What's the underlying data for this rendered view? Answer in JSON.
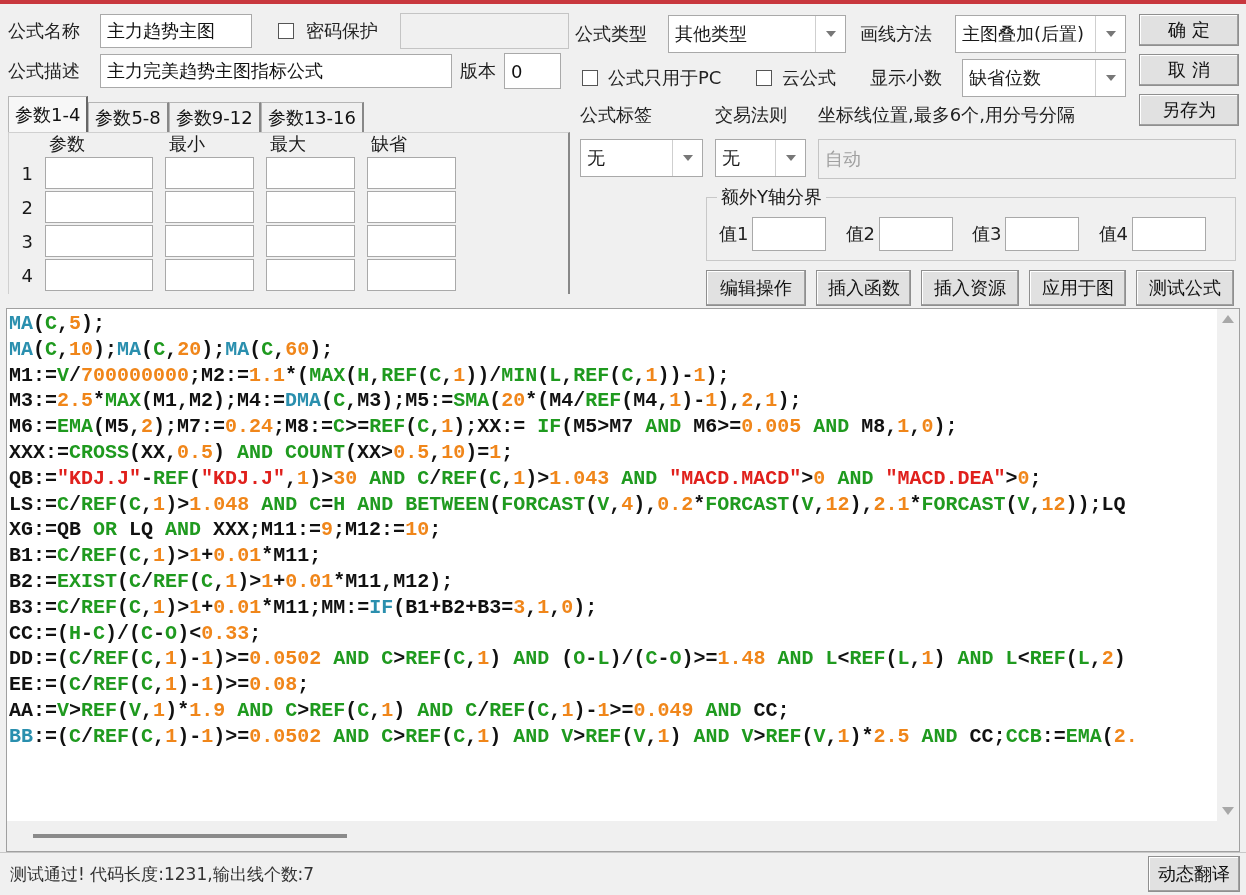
{
  "formula_name": {
    "label": "公式名称",
    "value": "主力趋势主图"
  },
  "password": {
    "label": "密码保护",
    "checked": false
  },
  "password_field": {
    "disabled": true
  },
  "description": {
    "label": "公式描述",
    "value": "主力完美趋势主图指标公式"
  },
  "version": {
    "label": "版本",
    "value": "0"
  },
  "param_tabs": [
    {
      "label": "参数1-4",
      "selected": true
    },
    {
      "label": "参数5-8",
      "selected": false
    },
    {
      "label": "参数9-12",
      "selected": false
    },
    {
      "label": "参数13-16",
      "selected": false
    }
  ],
  "param_table": {
    "columns": [
      "参数",
      "最小",
      "最大",
      "缺省"
    ],
    "rows": [
      {
        "index": "1"
      },
      {
        "index": "2"
      },
      {
        "index": "3"
      },
      {
        "index": "4"
      }
    ]
  },
  "formula_type": {
    "label": "公式类型",
    "value": "其他类型"
  },
  "draw_method": {
    "label": "画线方法",
    "value": "主图叠加(后置)"
  },
  "pc_only": {
    "label": "公式只用于PC",
    "checked": false
  },
  "cloud": {
    "label": "云公式",
    "checked": false
  },
  "decimals": {
    "label": "显示小数",
    "value": "缺省位数"
  },
  "side_buttons": [
    "确 定",
    "取 消",
    "另存为"
  ],
  "tag": {
    "label": "公式标签",
    "value": "无"
  },
  "trade_rule": {
    "label": "交易法则",
    "value": "无"
  },
  "axis_lines": {
    "label": "坐标线位置,最多6个,用分号分隔",
    "placeholder": "自动",
    "disabled": true
  },
  "extra_y": {
    "title": "额外Y轴分界",
    "fields": [
      {
        "label": "值1"
      },
      {
        "label": "值2"
      },
      {
        "label": "值3"
      },
      {
        "label": "值4"
      }
    ]
  },
  "action_buttons": [
    "编辑操作",
    "插入函数",
    "插入资源",
    "应用于图",
    "测试公式"
  ],
  "code": {
    "lines": [
      {
        "segments": [
          {
            "kind": "sys",
            "text": "MA"
          },
          {
            "kind": "txt",
            "text": "("
          },
          {
            "kind": "fn",
            "text": "C"
          },
          {
            "kind": "txt",
            "text": ","
          },
          {
            "kind": "num",
            "text": "5"
          },
          {
            "kind": "txt",
            "text": ");"
          }
        ]
      },
      {
        "segments": [
          {
            "kind": "sys",
            "text": "MA"
          },
          {
            "kind": "txt",
            "text": "("
          },
          {
            "kind": "fn",
            "text": "C"
          },
          {
            "kind": "txt",
            "text": ","
          },
          {
            "kind": "num",
            "text": "10"
          },
          {
            "kind": "txt",
            "text": ");"
          },
          {
            "kind": "sys",
            "text": "MA"
          },
          {
            "kind": "txt",
            "text": "("
          },
          {
            "kind": "fn",
            "text": "C"
          },
          {
            "kind": "txt",
            "text": ","
          },
          {
            "kind": "num",
            "text": "20"
          },
          {
            "kind": "txt",
            "text": ");"
          },
          {
            "kind": "sys",
            "text": "MA"
          },
          {
            "kind": "txt",
            "text": "("
          },
          {
            "kind": "fn",
            "text": "C"
          },
          {
            "kind": "txt",
            "text": ","
          },
          {
            "kind": "num",
            "text": "60"
          },
          {
            "kind": "txt",
            "text": ");"
          }
        ]
      },
      {
        "segments": [
          {
            "kind": "txt",
            "text": "M1:="
          },
          {
            "kind": "fn",
            "text": "V"
          },
          {
            "kind": "txt",
            "text": "/"
          },
          {
            "kind": "num",
            "text": "700000000"
          },
          {
            "kind": "txt",
            "text": ";M2:="
          },
          {
            "kind": "num",
            "text": "1.1"
          },
          {
            "kind": "txt",
            "text": "*("
          },
          {
            "kind": "fn",
            "text": "MAX"
          },
          {
            "kind": "txt",
            "text": "("
          },
          {
            "kind": "fn",
            "text": "H"
          },
          {
            "kind": "txt",
            "text": ","
          },
          {
            "kind": "fn",
            "text": "REF"
          },
          {
            "kind": "txt",
            "text": "("
          },
          {
            "kind": "fn",
            "text": "C"
          },
          {
            "kind": "txt",
            "text": ","
          },
          {
            "kind": "num",
            "text": "1"
          },
          {
            "kind": "txt",
            "text": "))/"
          },
          {
            "kind": "fn",
            "text": "MIN"
          },
          {
            "kind": "txt",
            "text": "("
          },
          {
            "kind": "fn",
            "text": "L"
          },
          {
            "kind": "txt",
            "text": ","
          },
          {
            "kind": "fn",
            "text": "REF"
          },
          {
            "kind": "txt",
            "text": "("
          },
          {
            "kind": "fn",
            "text": "C"
          },
          {
            "kind": "txt",
            "text": ","
          },
          {
            "kind": "num",
            "text": "1"
          },
          {
            "kind": "txt",
            "text": "))-"
          },
          {
            "kind": "num",
            "text": "1"
          },
          {
            "kind": "txt",
            "text": ");"
          }
        ]
      },
      {
        "segments": [
          {
            "kind": "txt",
            "text": "M3:="
          },
          {
            "kind": "num",
            "text": "2.5"
          },
          {
            "kind": "txt",
            "text": "*"
          },
          {
            "kind": "fn",
            "text": "MAX"
          },
          {
            "kind": "txt",
            "text": "(M1,M2);M4:="
          },
          {
            "kind": "sys",
            "text": "DMA"
          },
          {
            "kind": "txt",
            "text": "("
          },
          {
            "kind": "fn",
            "text": "C"
          },
          {
            "kind": "txt",
            "text": ",M3);M5:="
          },
          {
            "kind": "fn",
            "text": "SMA"
          },
          {
            "kind": "txt",
            "text": "("
          },
          {
            "kind": "num",
            "text": "20"
          },
          {
            "kind": "txt",
            "text": "*(M4/"
          },
          {
            "kind": "fn",
            "text": "REF"
          },
          {
            "kind": "txt",
            "text": "(M4,"
          },
          {
            "kind": "num",
            "text": "1"
          },
          {
            "kind": "txt",
            "text": ")-"
          },
          {
            "kind": "num",
            "text": "1"
          },
          {
            "kind": "txt",
            "text": "),"
          },
          {
            "kind": "num",
            "text": "2"
          },
          {
            "kind": "txt",
            "text": ","
          },
          {
            "kind": "num",
            "text": "1"
          },
          {
            "kind": "txt",
            "text": ");"
          }
        ]
      },
      {
        "segments": [
          {
            "kind": "txt",
            "text": "M6:="
          },
          {
            "kind": "fn",
            "text": "EMA"
          },
          {
            "kind": "txt",
            "text": "(M5,"
          },
          {
            "kind": "num",
            "text": "2"
          },
          {
            "kind": "txt",
            "text": ");M7:="
          },
          {
            "kind": "num",
            "text": "0.24"
          },
          {
            "kind": "txt",
            "text": ";M8:="
          },
          {
            "kind": "fn",
            "text": "C"
          },
          {
            "kind": "txt",
            "text": ">="
          },
          {
            "kind": "fn",
            "text": "REF"
          },
          {
            "kind": "txt",
            "text": "("
          },
          {
            "kind": "fn",
            "text": "C"
          },
          {
            "kind": "txt",
            "text": ","
          },
          {
            "kind": "num",
            "text": "1"
          },
          {
            "kind": "txt",
            "text": ");XX:= "
          },
          {
            "kind": "fn",
            "text": "IF"
          },
          {
            "kind": "txt",
            "text": "(M5>M7 "
          },
          {
            "kind": "fn",
            "text": "AND"
          },
          {
            "kind": "txt",
            "text": " M6>="
          },
          {
            "kind": "num",
            "text": "0.005"
          },
          {
            "kind": "fn",
            "text": " AND"
          },
          {
            "kind": "txt",
            "text": " M8,"
          },
          {
            "kind": "num",
            "text": "1"
          },
          {
            "kind": "txt",
            "text": ","
          },
          {
            "kind": "num",
            "text": "0"
          },
          {
            "kind": "txt",
            "text": ");"
          }
        ]
      },
      {
        "segments": [
          {
            "kind": "txt",
            "text": "XXX:="
          },
          {
            "kind": "fn",
            "text": "CROSS"
          },
          {
            "kind": "txt",
            "text": "(XX,"
          },
          {
            "kind": "num",
            "text": "0.5"
          },
          {
            "kind": "txt",
            "text": ") "
          },
          {
            "kind": "fn",
            "text": "AND COUNT"
          },
          {
            "kind": "txt",
            "text": "(XX>"
          },
          {
            "kind": "num",
            "text": "0.5"
          },
          {
            "kind": "txt",
            "text": ","
          },
          {
            "kind": "num",
            "text": "10"
          },
          {
            "kind": "txt",
            "text": ")="
          },
          {
            "kind": "num",
            "text": "1"
          },
          {
            "kind": "txt",
            "text": ";"
          }
        ]
      },
      {
        "segments": [
          {
            "kind": "txt",
            "text": "QB:="
          },
          {
            "kind": "str",
            "text": "\"KDJ.J\""
          },
          {
            "kind": "txt",
            "text": "-"
          },
          {
            "kind": "fn",
            "text": "REF"
          },
          {
            "kind": "txt",
            "text": "("
          },
          {
            "kind": "str",
            "text": "\"KDJ.J\""
          },
          {
            "kind": "txt",
            "text": ","
          },
          {
            "kind": "num",
            "text": "1"
          },
          {
            "kind": "txt",
            "text": ")>"
          },
          {
            "kind": "num",
            "text": "30"
          },
          {
            "kind": "fn",
            "text": " AND C"
          },
          {
            "kind": "txt",
            "text": "/"
          },
          {
            "kind": "fn",
            "text": "REF"
          },
          {
            "kind": "txt",
            "text": "("
          },
          {
            "kind": "fn",
            "text": "C"
          },
          {
            "kind": "txt",
            "text": ","
          },
          {
            "kind": "num",
            "text": "1"
          },
          {
            "kind": "txt",
            "text": ")>"
          },
          {
            "kind": "num",
            "text": "1.043"
          },
          {
            "kind": "fn",
            "text": " AND"
          },
          {
            "kind": "str",
            "text": " \"MACD.MACD\""
          },
          {
            "kind": "txt",
            "text": ">"
          },
          {
            "kind": "num",
            "text": "0"
          },
          {
            "kind": "fn",
            "text": " AND"
          },
          {
            "kind": "str",
            "text": " \"MACD.DEA\""
          },
          {
            "kind": "txt",
            "text": ">"
          },
          {
            "kind": "num",
            "text": "0"
          },
          {
            "kind": "txt",
            "text": ";"
          }
        ]
      },
      {
        "segments": [
          {
            "kind": "txt",
            "text": "LS:="
          },
          {
            "kind": "fn",
            "text": "C"
          },
          {
            "kind": "txt",
            "text": "/"
          },
          {
            "kind": "fn",
            "text": "REF"
          },
          {
            "kind": "txt",
            "text": "("
          },
          {
            "kind": "fn",
            "text": "C"
          },
          {
            "kind": "txt",
            "text": ","
          },
          {
            "kind": "num",
            "text": "1"
          },
          {
            "kind": "txt",
            "text": ")>"
          },
          {
            "kind": "num",
            "text": "1.048"
          },
          {
            "kind": "fn",
            "text": " AND C"
          },
          {
            "kind": "txt",
            "text": "="
          },
          {
            "kind": "fn",
            "text": "H AND BETWEEN"
          },
          {
            "kind": "txt",
            "text": "("
          },
          {
            "kind": "fn",
            "text": "FORCAST"
          },
          {
            "kind": "txt",
            "text": "("
          },
          {
            "kind": "fn",
            "text": "V"
          },
          {
            "kind": "txt",
            "text": ","
          },
          {
            "kind": "num",
            "text": "4"
          },
          {
            "kind": "txt",
            "text": "),"
          },
          {
            "kind": "num",
            "text": "0.2"
          },
          {
            "kind": "txt",
            "text": "*"
          },
          {
            "kind": "fn",
            "text": "FORCAST"
          },
          {
            "kind": "txt",
            "text": "("
          },
          {
            "kind": "fn",
            "text": "V"
          },
          {
            "kind": "txt",
            "text": ","
          },
          {
            "kind": "num",
            "text": "12"
          },
          {
            "kind": "txt",
            "text": "),"
          },
          {
            "kind": "num",
            "text": "2.1"
          },
          {
            "kind": "txt",
            "text": "*"
          },
          {
            "kind": "fn",
            "text": "FORCAST"
          },
          {
            "kind": "txt",
            "text": "("
          },
          {
            "kind": "fn",
            "text": "V"
          },
          {
            "kind": "txt",
            "text": ","
          },
          {
            "kind": "num",
            "text": "12"
          },
          {
            "kind": "txt",
            "text": "));LQ"
          }
        ]
      },
      {
        "segments": [
          {
            "kind": "txt",
            "text": "XG:=QB "
          },
          {
            "kind": "fn",
            "text": "OR"
          },
          {
            "kind": "txt",
            "text": " LQ "
          },
          {
            "kind": "fn",
            "text": "AND"
          },
          {
            "kind": "txt",
            "text": " XXX;M11:="
          },
          {
            "kind": "num",
            "text": "9"
          },
          {
            "kind": "txt",
            "text": ";M12:="
          },
          {
            "kind": "num",
            "text": "10"
          },
          {
            "kind": "txt",
            "text": ";"
          }
        ]
      },
      {
        "segments": [
          {
            "kind": "txt",
            "text": "B1:="
          },
          {
            "kind": "fn",
            "text": "C"
          },
          {
            "kind": "txt",
            "text": "/"
          },
          {
            "kind": "fn",
            "text": "REF"
          },
          {
            "kind": "txt",
            "text": "("
          },
          {
            "kind": "fn",
            "text": "C"
          },
          {
            "kind": "txt",
            "text": ","
          },
          {
            "kind": "num",
            "text": "1"
          },
          {
            "kind": "txt",
            "text": ")>"
          },
          {
            "kind": "num",
            "text": "1"
          },
          {
            "kind": "txt",
            "text": "+"
          },
          {
            "kind": "num",
            "text": "0.01"
          },
          {
            "kind": "txt",
            "text": "*M11;"
          }
        ]
      },
      {
        "segments": [
          {
            "kind": "txt",
            "text": "B2:="
          },
          {
            "kind": "fn",
            "text": "EXIST"
          },
          {
            "kind": "txt",
            "text": "("
          },
          {
            "kind": "fn",
            "text": "C"
          },
          {
            "kind": "txt",
            "text": "/"
          },
          {
            "kind": "fn",
            "text": "REF"
          },
          {
            "kind": "txt",
            "text": "("
          },
          {
            "kind": "fn",
            "text": "C"
          },
          {
            "kind": "txt",
            "text": ","
          },
          {
            "kind": "num",
            "text": "1"
          },
          {
            "kind": "txt",
            "text": ")>"
          },
          {
            "kind": "num",
            "text": "1"
          },
          {
            "kind": "txt",
            "text": "+"
          },
          {
            "kind": "num",
            "text": "0.01"
          },
          {
            "kind": "txt",
            "text": "*M11,M12);"
          }
        ]
      },
      {
        "segments": [
          {
            "kind": "txt",
            "text": "B3:="
          },
          {
            "kind": "fn",
            "text": "C"
          },
          {
            "kind": "txt",
            "text": "/"
          },
          {
            "kind": "fn",
            "text": "REF"
          },
          {
            "kind": "txt",
            "text": "("
          },
          {
            "kind": "fn",
            "text": "C"
          },
          {
            "kind": "txt",
            "text": ","
          },
          {
            "kind": "num",
            "text": "1"
          },
          {
            "kind": "txt",
            "text": ")>"
          },
          {
            "kind": "num",
            "text": "1"
          },
          {
            "kind": "txt",
            "text": "+"
          },
          {
            "kind": "num",
            "text": "0.01"
          },
          {
            "kind": "txt",
            "text": "*M11;MM:="
          },
          {
            "kind": "sys",
            "text": "IF"
          },
          {
            "kind": "txt",
            "text": "(B1+B2+B3="
          },
          {
            "kind": "num",
            "text": "3"
          },
          {
            "kind": "txt",
            "text": ","
          },
          {
            "kind": "num",
            "text": "1"
          },
          {
            "kind": "txt",
            "text": ","
          },
          {
            "kind": "num",
            "text": "0"
          },
          {
            "kind": "txt",
            "text": ");"
          }
        ]
      },
      {
        "segments": [
          {
            "kind": "txt",
            "text": "CC:=("
          },
          {
            "kind": "fn",
            "text": "H"
          },
          {
            "kind": "txt",
            "text": "-"
          },
          {
            "kind": "fn",
            "text": "C"
          },
          {
            "kind": "txt",
            "text": ")/("
          },
          {
            "kind": "fn",
            "text": "C"
          },
          {
            "kind": "txt",
            "text": "-"
          },
          {
            "kind": "fn",
            "text": "O"
          },
          {
            "kind": "txt",
            "text": ")<"
          },
          {
            "kind": "num",
            "text": "0.33"
          },
          {
            "kind": "txt",
            "text": ";"
          }
        ]
      },
      {
        "segments": [
          {
            "kind": "txt",
            "text": "DD:=("
          },
          {
            "kind": "fn",
            "text": "C"
          },
          {
            "kind": "txt",
            "text": "/"
          },
          {
            "kind": "fn",
            "text": "REF"
          },
          {
            "kind": "txt",
            "text": "("
          },
          {
            "kind": "fn",
            "text": "C"
          },
          {
            "kind": "txt",
            "text": ","
          },
          {
            "kind": "num",
            "text": "1"
          },
          {
            "kind": "txt",
            "text": ")-"
          },
          {
            "kind": "num",
            "text": "1"
          },
          {
            "kind": "txt",
            "text": ")>="
          },
          {
            "kind": "num",
            "text": "0.0502"
          },
          {
            "kind": "fn",
            "text": " AND C"
          },
          {
            "kind": "txt",
            "text": ">"
          },
          {
            "kind": "fn",
            "text": "REF"
          },
          {
            "kind": "txt",
            "text": "("
          },
          {
            "kind": "fn",
            "text": "C"
          },
          {
            "kind": "txt",
            "text": ","
          },
          {
            "kind": "num",
            "text": "1"
          },
          {
            "kind": "txt",
            "text": ") "
          },
          {
            "kind": "fn",
            "text": "AND"
          },
          {
            "kind": "txt",
            "text": " ("
          },
          {
            "kind": "fn",
            "text": "O"
          },
          {
            "kind": "txt",
            "text": "-"
          },
          {
            "kind": "fn",
            "text": "L"
          },
          {
            "kind": "txt",
            "text": ")/("
          },
          {
            "kind": "fn",
            "text": "C"
          },
          {
            "kind": "txt",
            "text": "-"
          },
          {
            "kind": "fn",
            "text": "O"
          },
          {
            "kind": "txt",
            "text": ")>="
          },
          {
            "kind": "num",
            "text": "1.48"
          },
          {
            "kind": "fn",
            "text": " AND L"
          },
          {
            "kind": "txt",
            "text": "<"
          },
          {
            "kind": "fn",
            "text": "REF"
          },
          {
            "kind": "txt",
            "text": "("
          },
          {
            "kind": "fn",
            "text": "L"
          },
          {
            "kind": "txt",
            "text": ","
          },
          {
            "kind": "num",
            "text": "1"
          },
          {
            "kind": "txt",
            "text": ") "
          },
          {
            "kind": "fn",
            "text": "AND L"
          },
          {
            "kind": "txt",
            "text": "<"
          },
          {
            "kind": "fn",
            "text": "REF"
          },
          {
            "kind": "txt",
            "text": "("
          },
          {
            "kind": "fn",
            "text": "L"
          },
          {
            "kind": "txt",
            "text": ","
          },
          {
            "kind": "num",
            "text": "2"
          },
          {
            "kind": "txt",
            "text": ")"
          }
        ]
      },
      {
        "segments": [
          {
            "kind": "txt",
            "text": "EE:=("
          },
          {
            "kind": "fn",
            "text": "C"
          },
          {
            "kind": "txt",
            "text": "/"
          },
          {
            "kind": "fn",
            "text": "REF"
          },
          {
            "kind": "txt",
            "text": "("
          },
          {
            "kind": "fn",
            "text": "C"
          },
          {
            "kind": "txt",
            "text": ","
          },
          {
            "kind": "num",
            "text": "1"
          },
          {
            "kind": "txt",
            "text": ")-"
          },
          {
            "kind": "num",
            "text": "1"
          },
          {
            "kind": "txt",
            "text": ")>="
          },
          {
            "kind": "num",
            "text": "0.08"
          },
          {
            "kind": "txt",
            "text": ";"
          }
        ]
      },
      {
        "segments": [
          {
            "kind": "txt",
            "text": "AA:="
          },
          {
            "kind": "fn",
            "text": "V"
          },
          {
            "kind": "txt",
            "text": ">"
          },
          {
            "kind": "fn",
            "text": "REF"
          },
          {
            "kind": "txt",
            "text": "("
          },
          {
            "kind": "fn",
            "text": "V"
          },
          {
            "kind": "txt",
            "text": ","
          },
          {
            "kind": "num",
            "text": "1"
          },
          {
            "kind": "txt",
            "text": ")*"
          },
          {
            "kind": "num",
            "text": "1.9"
          },
          {
            "kind": "fn",
            "text": " AND C"
          },
          {
            "kind": "txt",
            "text": ">"
          },
          {
            "kind": "fn",
            "text": "REF"
          },
          {
            "kind": "txt",
            "text": "("
          },
          {
            "kind": "fn",
            "text": "C"
          },
          {
            "kind": "txt",
            "text": ","
          },
          {
            "kind": "num",
            "text": "1"
          },
          {
            "kind": "txt",
            "text": ") "
          },
          {
            "kind": "fn",
            "text": "AND C"
          },
          {
            "kind": "txt",
            "text": "/"
          },
          {
            "kind": "fn",
            "text": "REF"
          },
          {
            "kind": "txt",
            "text": "("
          },
          {
            "kind": "fn",
            "text": "C"
          },
          {
            "kind": "txt",
            "text": ","
          },
          {
            "kind": "num",
            "text": "1"
          },
          {
            "kind": "txt",
            "text": ")-"
          },
          {
            "kind": "num",
            "text": "1"
          },
          {
            "kind": "txt",
            "text": ">="
          },
          {
            "kind": "num",
            "text": "0.049"
          },
          {
            "kind": "fn",
            "text": " AND"
          },
          {
            "kind": "txt",
            "text": " CC;"
          }
        ]
      },
      {
        "segments": [
          {
            "kind": "sys",
            "text": "BB"
          },
          {
            "kind": "txt",
            "text": ":=("
          },
          {
            "kind": "fn",
            "text": "C"
          },
          {
            "kind": "txt",
            "text": "/"
          },
          {
            "kind": "fn",
            "text": "REF"
          },
          {
            "kind": "txt",
            "text": "("
          },
          {
            "kind": "fn",
            "text": "C"
          },
          {
            "kind": "txt",
            "text": ","
          },
          {
            "kind": "num",
            "text": "1"
          },
          {
            "kind": "txt",
            "text": ")-"
          },
          {
            "kind": "num",
            "text": "1"
          },
          {
            "kind": "txt",
            "text": ")>="
          },
          {
            "kind": "num",
            "text": "0.0502"
          },
          {
            "kind": "fn",
            "text": " AND C"
          },
          {
            "kind": "txt",
            "text": ">"
          },
          {
            "kind": "fn",
            "text": "REF"
          },
          {
            "kind": "txt",
            "text": "("
          },
          {
            "kind": "fn",
            "text": "C"
          },
          {
            "kind": "txt",
            "text": ","
          },
          {
            "kind": "num",
            "text": "1"
          },
          {
            "kind": "txt",
            "text": ") "
          },
          {
            "kind": "fn",
            "text": "AND V"
          },
          {
            "kind": "txt",
            "text": ">"
          },
          {
            "kind": "fn",
            "text": "REF"
          },
          {
            "kind": "txt",
            "text": "("
          },
          {
            "kind": "fn",
            "text": "V"
          },
          {
            "kind": "txt",
            "text": ","
          },
          {
            "kind": "num",
            "text": "1"
          },
          {
            "kind": "txt",
            "text": ") "
          },
          {
            "kind": "fn",
            "text": "AND V"
          },
          {
            "kind": "txt",
            "text": ">"
          },
          {
            "kind": "fn",
            "text": "REF"
          },
          {
            "kind": "txt",
            "text": "("
          },
          {
            "kind": "fn",
            "text": "V"
          },
          {
            "kind": "txt",
            "text": ","
          },
          {
            "kind": "num",
            "text": "1"
          },
          {
            "kind": "txt",
            "text": ")*"
          },
          {
            "kind": "num",
            "text": "2.5"
          },
          {
            "kind": "fn",
            "text": " AND"
          },
          {
            "kind": "txt",
            "text": " CC;"
          },
          {
            "kind": "fn",
            "text": "CCB"
          },
          {
            "kind": "txt",
            "text": ":="
          },
          {
            "kind": "fn",
            "text": "EMA"
          },
          {
            "kind": "txt",
            "text": "("
          },
          {
            "kind": "num",
            "text": "2."
          }
        ]
      }
    ]
  },
  "status": {
    "message": "测试通过! 代码长度:1231,输出线个数:7",
    "button": "动态翻译"
  }
}
